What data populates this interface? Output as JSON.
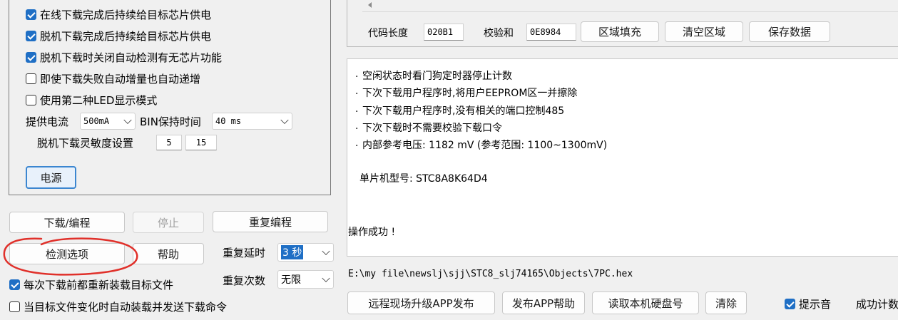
{
  "left_panel": {
    "checkboxes": [
      {
        "label": "在线下载完成后持续给目标芯片供电",
        "checked": true
      },
      {
        "label": "脱机下载完成后持续给目标芯片供电",
        "checked": true
      },
      {
        "label": "脱机下载时关闭自动检测有无芯片功能",
        "checked": true
      },
      {
        "label": "即使下载失败自动增量也自动递增",
        "checked": false
      },
      {
        "label": "使用第二种LED显示模式",
        "checked": false
      }
    ],
    "supply_current_label": "提供电流",
    "supply_current_value": "500mA",
    "bin_hold_label": "BIN保持时间",
    "bin_hold_value": "40 ms",
    "offline_sensitivity_label": "脱机下载灵敏度设置",
    "sensitivity_a": "5",
    "sensitivity_b": "15",
    "power_button": "电源"
  },
  "actions": {
    "download": "下载/编程",
    "stop": "停止",
    "repeat_program": "重复编程",
    "check_options": "检测选项",
    "help": "帮助",
    "repeat_delay_label": "重复延时",
    "repeat_delay_value": "3 秒",
    "repeat_count_label": "重复次数",
    "repeat_count_value": "无限",
    "reload_before_download": {
      "label": "每次下载前都重新装载目标文件",
      "checked": true
    },
    "auto_reload_on_change": {
      "label": "当目标文件变化时自动装载并发送下载命令",
      "checked": false
    }
  },
  "code_panel": {
    "code_length_label": "代码长度",
    "code_length_value": "020B1",
    "checksum_label": "校验和",
    "checksum_value": "0E8984",
    "fill_button": "区域填充",
    "clear_area_button": "清空区域",
    "save_button": "保存数据"
  },
  "log": {
    "lines": [
      "空闲状态时看门狗定时器停止计数",
      "下次下载用户程序时,将用户EEPROM区一并擦除",
      "下次下载用户程序时,没有相关的端口控制485",
      "下次下载时不需要校验下载口令",
      "内部参考电压: 1182 mV (参考范围: 1100~1300mV)"
    ],
    "bullet": ".",
    "mcu_model": "单片机型号: STC8A8K64D4",
    "result": "操作成功 !"
  },
  "file_path": "E:\\my file\\newslj\\sjj\\STC8_slj74165\\Objects\\7PC.hex",
  "bottom_bar": {
    "remote_upgrade": "远程现场升级APP发布",
    "publish_help": "发布APP帮助",
    "read_disk_id": "读取本机硬盘号",
    "clear": "清除",
    "beep": {
      "label": "提示音",
      "checked": true
    },
    "success_count_label": "成功计数"
  },
  "colors": {
    "accent": "#1f6fc5",
    "annotation": "#e0302a"
  }
}
